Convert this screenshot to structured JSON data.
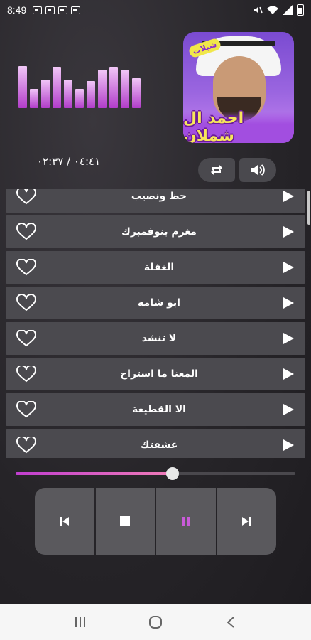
{
  "status_bar": {
    "time": "8:49",
    "notification_icons": [
      "image-icon",
      "image-icon",
      "image-icon",
      "image-icon"
    ],
    "system_icons": [
      "mute-icon",
      "wifi-icon",
      "signal-icon",
      "battery-icon"
    ]
  },
  "equalizer": {
    "levels": [
      0.92,
      0.42,
      0.62,
      0.9,
      0.62,
      0.42,
      0.6,
      0.85,
      0.9,
      0.85,
      0.66
    ],
    "colors": {
      "bottom": "#b13cc9",
      "top": "#f1c7f7"
    }
  },
  "album": {
    "badge": "شيلات",
    "artist": "احمد ال شملان"
  },
  "player": {
    "time_text": "٠٤:٤١ / ٠٢:٣٧",
    "progress": 0.56,
    "accent": "#c13ed0"
  },
  "mini_controls": [
    {
      "name": "repeat-icon"
    },
    {
      "name": "volume-icon"
    }
  ],
  "songs": [
    {
      "title": "حظ ونصيب"
    },
    {
      "title": "مغرم بنوفمبرك"
    },
    {
      "title": "الغفلة"
    },
    {
      "title": "ابو شامه"
    },
    {
      "title": "لا تنشد"
    },
    {
      "title": "المعنا ما استراح"
    },
    {
      "title": "الا القطيعة"
    },
    {
      "title": "عشقتك"
    }
  ],
  "transport": [
    {
      "name": "previous-icon"
    },
    {
      "name": "stop-icon"
    },
    {
      "name": "pause-icon",
      "active": true
    },
    {
      "name": "next-icon"
    }
  ],
  "nav_bar": [
    "recents-icon",
    "home-icon",
    "back-icon"
  ]
}
